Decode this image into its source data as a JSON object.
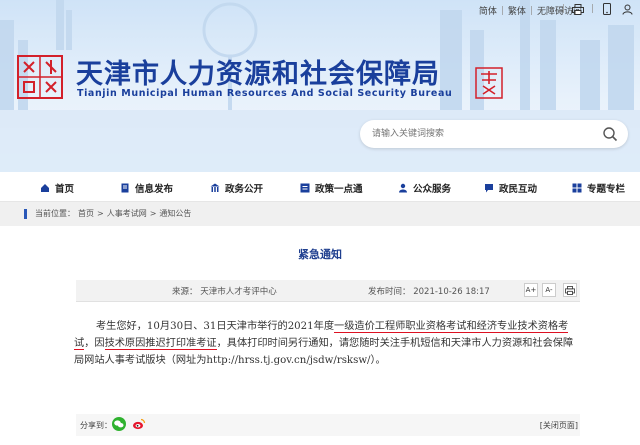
{
  "toplinks": [
    "简体",
    "繁体",
    "无障碍访问"
  ],
  "header": {
    "title_cn": "天津市人力资源和社会保障局",
    "title_en": "Tianjin Municipal Human Resources And Social Security Bureau"
  },
  "search": {
    "placeholder": "请输入关键词搜索"
  },
  "nav": [
    "首页",
    "信息发布",
    "政务公开",
    "政策一点通",
    "公众服务",
    "政民互动",
    "专题专栏"
  ],
  "breadcrumb": {
    "label": "当前位置：",
    "items": [
      "首页",
      "人事考试网",
      "通知公告"
    ],
    "sep": ">"
  },
  "article": {
    "title": "紧急通知",
    "source_label": "来源：",
    "source": "天津市人才考评中心",
    "time_label": "发布时间：",
    "time": "2021-10-26 18:17",
    "font_buttons": [
      "A+",
      "A-"
    ],
    "body": {
      "p1": "考生您好，10月30日、31日天津市举行的2021年度",
      "u1": "一级造价工程师职业资格考试和经济专业技术资格考试",
      "p2": "，因",
      "u2": "技术原因推迟打印准考证",
      "p3": "，具体打印时间另行通知，请您随时关注手机短信和天津市人力资源和社会保障局网站人事考试版块（网址为http://hrss.tj.gov.cn/jsdw/rsksw/）。"
    }
  },
  "share": {
    "label": "分享到：",
    "close": "[关闭页面]"
  },
  "colors": {
    "brand_blue": "#1a3f9c",
    "underline_red": "#dd1122"
  }
}
